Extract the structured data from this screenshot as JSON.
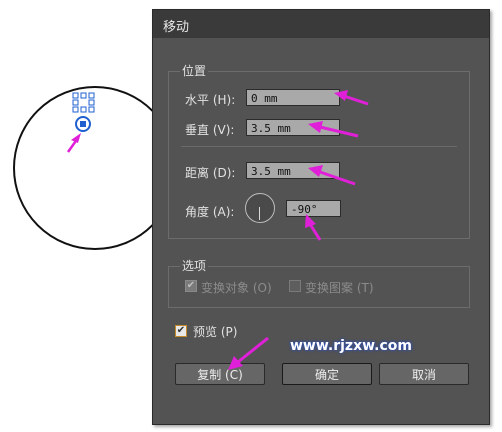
{
  "dialog": {
    "title": "移动",
    "position_group": {
      "legend": "位置",
      "horizontal_label": "水平 (H):",
      "horizontal_value": "0 mm",
      "vertical_label": "垂直 (V):",
      "vertical_value": "3.5 mm",
      "distance_label": "距离 (D):",
      "distance_value": "3.5 mm",
      "angle_label": "角度 (A):",
      "angle_value": "-90°"
    },
    "options_group": {
      "legend": "选项",
      "transform_objects_label": "变换对象 (O)",
      "transform_objects_checked": true,
      "transform_patterns_label": "变换图案 (T)",
      "transform_patterns_checked": false
    },
    "preview_label": "预览 (P)",
    "preview_checked": true,
    "copy_button": "复制 (C)",
    "ok_button": "确定",
    "cancel_button": "取消"
  },
  "watermark": "www.rjzxw.com",
  "colors": {
    "dialog_bg": "#535353",
    "field_bg": "#a9a9a9",
    "annotation_arrow": "#e020d8",
    "selection_blue": "#1f5fd0"
  }
}
